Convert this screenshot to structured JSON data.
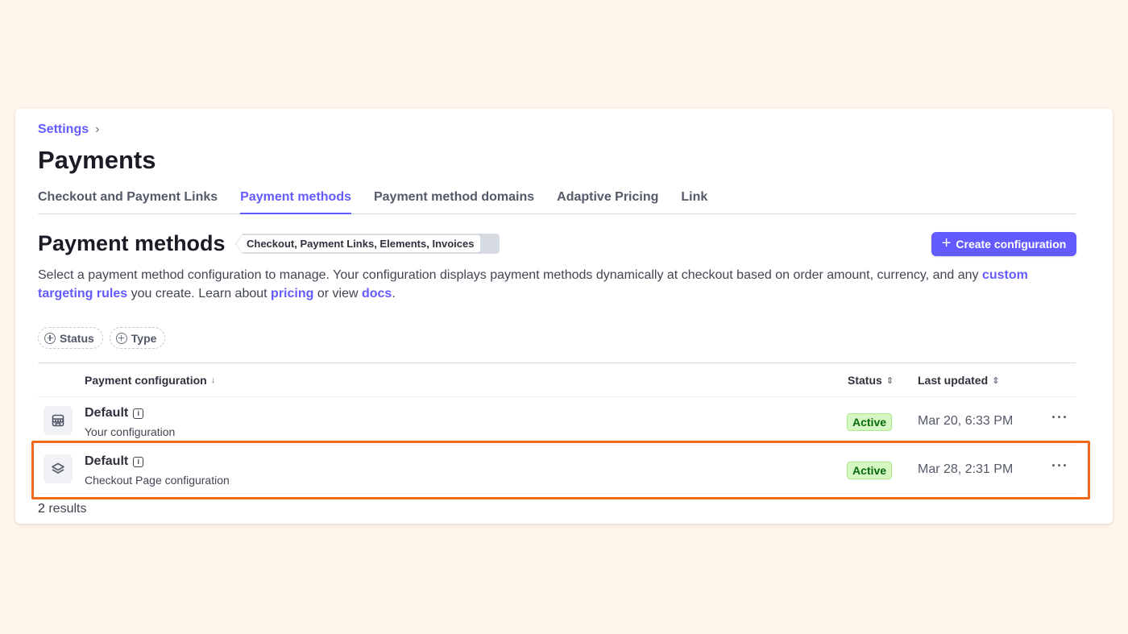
{
  "breadcrumb": {
    "parent": "Settings",
    "separator": "›"
  },
  "page_title": "Payments",
  "tabs": [
    {
      "label": "Checkout and Payment Links",
      "active": false
    },
    {
      "label": "Payment methods",
      "active": true
    },
    {
      "label": "Payment method domains",
      "active": false
    },
    {
      "label": "Adaptive Pricing",
      "active": false
    },
    {
      "label": "Link",
      "active": false
    }
  ],
  "section": {
    "title": "Payment methods",
    "scope_badge": "Checkout, Payment Links, Elements, Invoices",
    "create_button": "Create configuration",
    "description": {
      "part1": "Select a payment method configuration to manage. Your configuration displays payment methods dynamically at checkout based on order amount, currency, and any ",
      "link1": "custom targeting rules",
      "part2": " you create. Learn about ",
      "link2": "pricing",
      "part3": " or view ",
      "link3": "docs",
      "part4": "."
    }
  },
  "filters": [
    {
      "label": "Status"
    },
    {
      "label": "Type"
    }
  ],
  "table": {
    "columns": {
      "config": "Payment configuration",
      "config_sort": "↓",
      "status": "Status",
      "status_sort": "⇕",
      "updated": "Last updated",
      "updated_sort": "⇕"
    },
    "rows": [
      {
        "icon": "storefront-icon",
        "title": "Default",
        "subtitle": "Your configuration",
        "status": "Active",
        "updated": "Mar 20, 6:33 PM"
      },
      {
        "icon": "layers-icon",
        "title": "Default",
        "subtitle": "Checkout Page configuration",
        "status": "Active",
        "updated": "Mar 28, 2:31 PM"
      }
    ]
  },
  "results": {
    "count": "2",
    "label": " results"
  },
  "colors": {
    "accent": "#635bff",
    "highlight": "#f06a1d",
    "active_bg": "#d7f7c2",
    "active_text": "#05690d"
  }
}
